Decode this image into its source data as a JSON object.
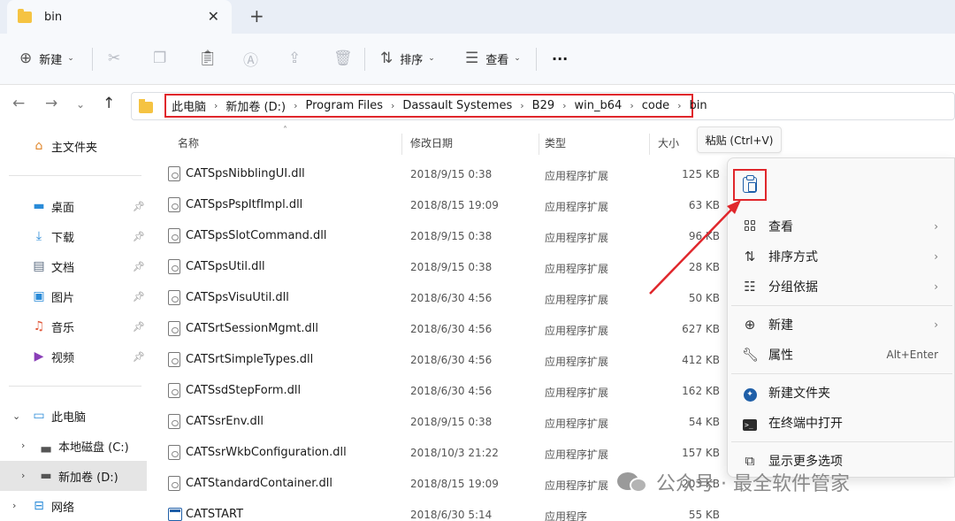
{
  "window": {
    "tab_title": "bin",
    "close_glyph": "✕",
    "new_tab_glyph": "+"
  },
  "toolbar": {
    "new_label": "新建",
    "sort_label": "排序",
    "view_label": "查看",
    "more_glyph": "···"
  },
  "address": {
    "crumbs": [
      "此电脑",
      "新加卷 (D:)",
      "Program Files",
      "Dassault Systemes",
      "B29",
      "win_b64",
      "code",
      "bin"
    ]
  },
  "sidebar": {
    "home": "主文件夹",
    "quick": [
      {
        "label": "桌面",
        "icon": "desktop-icon"
      },
      {
        "label": "下载",
        "icon": "download-icon"
      },
      {
        "label": "文档",
        "icon": "document-icon"
      },
      {
        "label": "图片",
        "icon": "pictures-icon"
      },
      {
        "label": "音乐",
        "icon": "music-icon"
      },
      {
        "label": "视频",
        "icon": "video-icon"
      }
    ],
    "this_pc": "此电脑",
    "drives": [
      {
        "label": "本地磁盘 (C:)",
        "selected": false
      },
      {
        "label": "新加卷 (D:)",
        "selected": true
      }
    ],
    "network": "网络"
  },
  "columns": {
    "name": "名称",
    "date": "修改日期",
    "type": "类型",
    "size": "大小"
  },
  "files": [
    {
      "name": "CATSpsNibblingUI.dll",
      "date": "2018/9/15 0:38",
      "type": "应用程序扩展",
      "size": "125 KB"
    },
    {
      "name": "CATSpsPspItfImpl.dll",
      "date": "2018/8/15 19:09",
      "type": "应用程序扩展",
      "size": "63 KB"
    },
    {
      "name": "CATSpsSlotCommand.dll",
      "date": "2018/9/15 0:38",
      "type": "应用程序扩展",
      "size": "96 KB"
    },
    {
      "name": "CATSpsUtil.dll",
      "date": "2018/9/15 0:38",
      "type": "应用程序扩展",
      "size": "28 KB"
    },
    {
      "name": "CATSpsVisuUtil.dll",
      "date": "2018/6/30 4:56",
      "type": "应用程序扩展",
      "size": "50 KB"
    },
    {
      "name": "CATSrtSessionMgmt.dll",
      "date": "2018/6/30 4:56",
      "type": "应用程序扩展",
      "size": "627 KB"
    },
    {
      "name": "CATSrtSimpleTypes.dll",
      "date": "2018/6/30 4:56",
      "type": "应用程序扩展",
      "size": "412 KB"
    },
    {
      "name": "CATSsdStepForm.dll",
      "date": "2018/6/30 4:56",
      "type": "应用程序扩展",
      "size": "162 KB"
    },
    {
      "name": "CATSsrEnv.dll",
      "date": "2018/9/15 0:38",
      "type": "应用程序扩展",
      "size": "54 KB"
    },
    {
      "name": "CATSsrWkbConfiguration.dll",
      "date": "2018/10/3 21:22",
      "type": "应用程序扩展",
      "size": "157 KB"
    },
    {
      "name": "CATStandardContainer.dll",
      "date": "2018/8/15 19:09",
      "type": "应用程序扩展",
      "size": "203 KB"
    },
    {
      "name": "CATSTART",
      "date": "2018/6/30 5:14",
      "type": "应用程序",
      "size": "55 KB"
    }
  ],
  "tooltip": "粘贴 (Ctrl+V)",
  "context_menu": {
    "items": [
      {
        "label": "查看",
        "arrow": "›"
      },
      {
        "label": "排序方式",
        "arrow": "›"
      },
      {
        "label": "分组依据",
        "arrow": "›"
      },
      {
        "label": "新建",
        "arrow": "›"
      },
      {
        "label": "属性",
        "shortcut": "Alt+Enter"
      },
      {
        "label": "新建文件夹"
      },
      {
        "label": "在终端中打开"
      },
      {
        "label": "显示更多选项"
      }
    ]
  },
  "watermark": "公众号 · 最全软件管家",
  "colors": {
    "highlight_red": "#e0272c",
    "folder_yellow": "#f5c342",
    "accent_blue": "#1f5fa8"
  }
}
